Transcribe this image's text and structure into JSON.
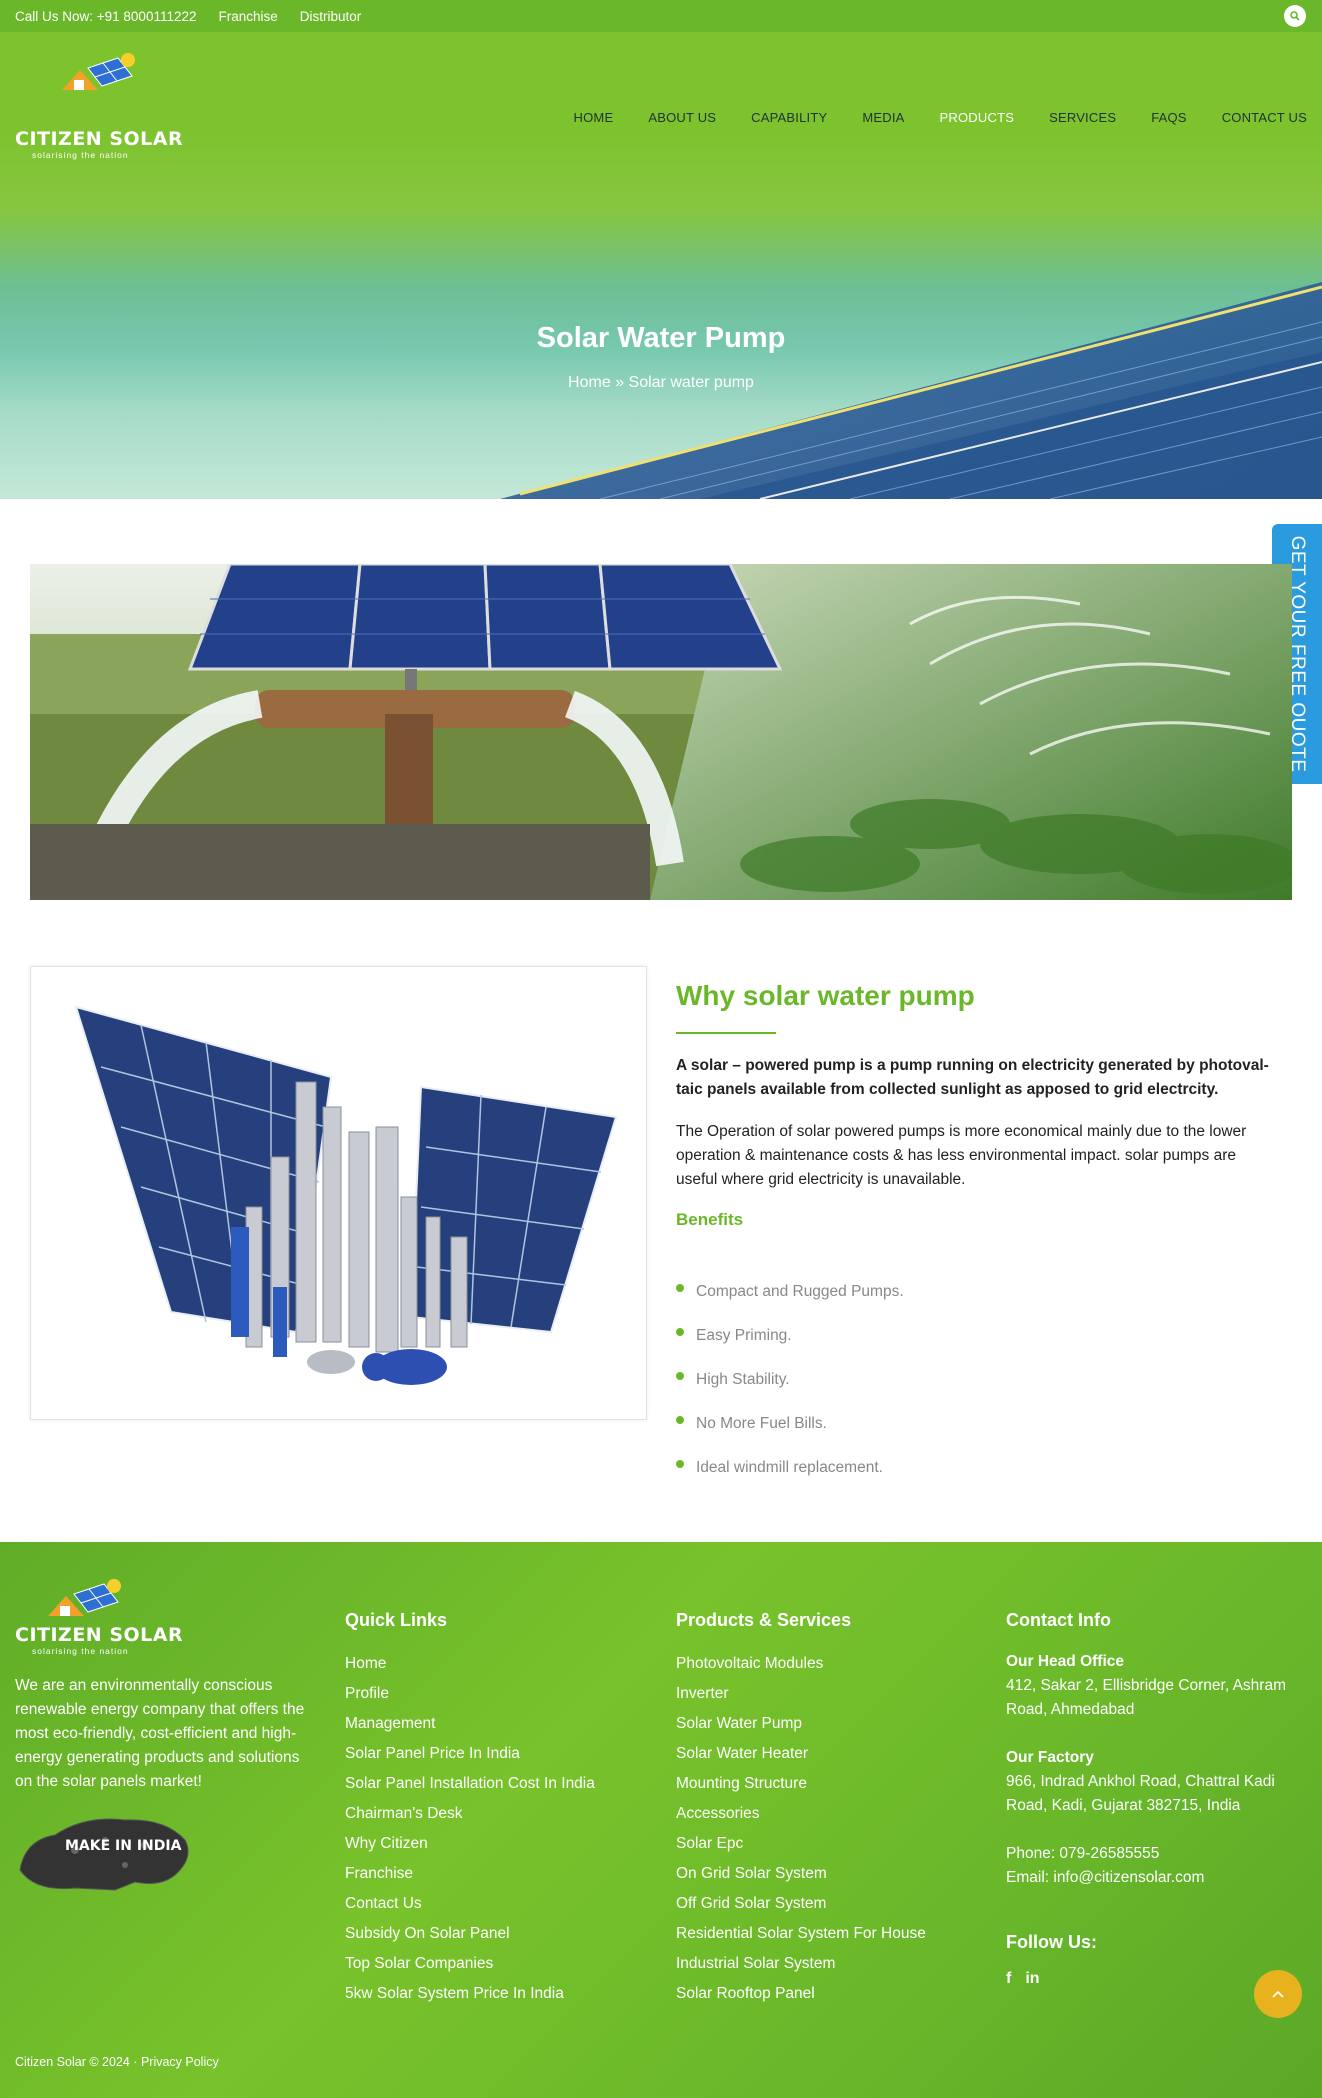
{
  "topbar": {
    "call": "Call Us Now: +91 8000111222",
    "franchise": "Franchise",
    "distributor": "Distributor"
  },
  "brand": {
    "name": "CITIZEN SOLAR",
    "tagline": "solarising the nation"
  },
  "nav": [
    "HOME",
    "ABOUT US",
    "CAPABILITY",
    "MEDIA",
    "PRODUCTS",
    "SERVICES",
    "FAQS",
    "CONTACT US"
  ],
  "hero": {
    "title": "Solar Water Pump",
    "breadcrumb_home": "Home",
    "breadcrumb_sep": "»",
    "breadcrumb_current": "Solar water pump"
  },
  "quote_tab": "GET YOUR FREE QUOTE",
  "content": {
    "title": "Why solar water pump",
    "intro": "A solar – powered pump is a pump running on electricity generated by photoval-taic panels available from collected sunlight as apposed to grid electrcity.",
    "body": "The Operation of solar powered pumps is more economical mainly due to the lower operation & maintenance costs & has less environmental impact. solar pumps are useful where grid electricity is unavailable.",
    "benefits_title": "Benefits",
    "benefits": [
      "Compact and Rugged Pumps.",
      "Easy Priming.",
      "High Stability.",
      "No More Fuel Bills.",
      "Ideal windmill replacement."
    ]
  },
  "footer": {
    "description": "We are an environmentally conscious renewable energy company that offers the most eco-friendly, cost-efficient and high-energy generating products and solutions on the solar panels market!",
    "make_in_india": "MAKE IN INDIA",
    "quick_links_title": "Quick Links",
    "quick_links": [
      "Home",
      "Profile",
      "Management",
      "Solar Panel Price In India",
      "Solar Panel Installation Cost In India",
      "Chairman's Desk",
      "Why Citizen",
      "Franchise",
      "Contact Us",
      "Subsidy On Solar Panel",
      "Top Solar Companies",
      "5kw Solar System Price In India"
    ],
    "products_title": "Products & Services",
    "products": [
      "Photovoltaic Modules",
      "Inverter",
      "Solar Water Pump",
      "Solar Water Heater",
      "Mounting Structure",
      "Accessories",
      "Solar Epc",
      "On Grid Solar System",
      "Off Grid Solar System",
      "Residential Solar System For House",
      "Industrial Solar System",
      "Solar Rooftop Panel"
    ],
    "contact_title": "Contact Info",
    "head_office_title": "Our Head Office",
    "head_office": "412, Sakar 2, Ellisbridge Corner, Ashram Road, Ahmedabad",
    "factory_title": "Our Factory",
    "factory": "966, Indrad Ankhol Road, Chattral Kadi Road, Kadi, Gujarat 382715, India",
    "phone": "Phone: 079-26585555",
    "email": "Email: info@citizensolar.com",
    "follow_title": "Follow Us:",
    "social": [
      "f",
      "in"
    ],
    "copyright": "Citizen Solar © 2024 · ",
    "privacy": "Privacy Policy"
  },
  "colors": {
    "brand_green": "#6ab82a",
    "quote_blue": "#2b9be0",
    "to_top_gold": "#e8b21f"
  }
}
